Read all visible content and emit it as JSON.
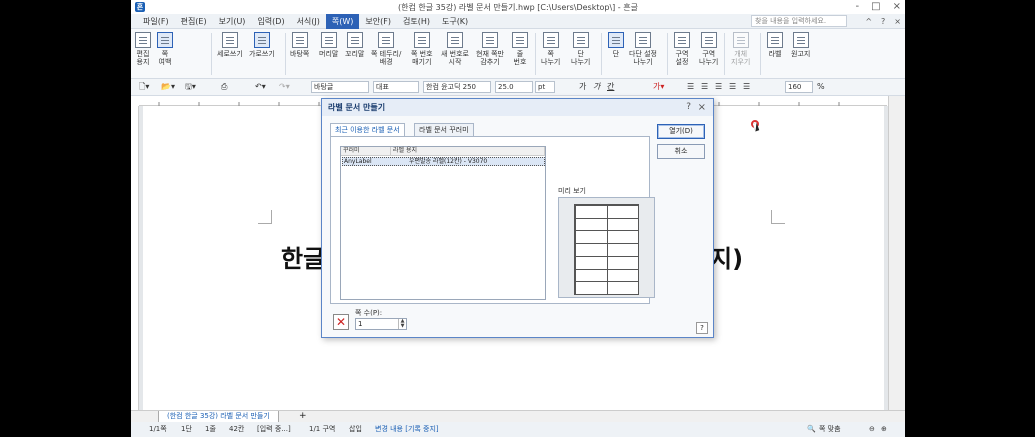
{
  "window": {
    "title": "(한컴 한글 35강) 라벨 문서 만들기.hwp [C:\\Users\\Desktop\\] - 흔글",
    "controls": [
      "-",
      "□",
      "×"
    ]
  },
  "menubar": {
    "items": [
      "파일(F)",
      "편집(E)",
      "보기(U)",
      "입력(D)",
      "서식(J)",
      "쪽(W)",
      "보안(F)",
      "검토(H)",
      "도구(K)"
    ],
    "active_index": 5,
    "search_placeholder": "찾을 내용을 입력하세요.",
    "right": [
      "^",
      "?",
      "×"
    ]
  },
  "ribbon": {
    "buttons": [
      {
        "label": "편집\n용지",
        "icon": "page-setup-icon"
      },
      {
        "label": "쪽\n여백",
        "icon": "page-margin-icon"
      },
      {
        "label": "세로쓰기",
        "icon": "vertical-writing-icon"
      },
      {
        "label": "가로쓰기",
        "icon": "horizontal-writing-icon",
        "selected": true
      },
      {
        "label": "바탕쪽",
        "icon": "master-page-icon"
      },
      {
        "label": "머리말",
        "icon": "header-icon"
      },
      {
        "label": "꼬리말",
        "icon": "footer-icon"
      },
      {
        "label": "쪽 테두리/\n배경",
        "icon": "page-border-icon"
      },
      {
        "label": "쪽 번호\n매기기",
        "icon": "page-number-icon"
      },
      {
        "label": "새 번호로\n시작",
        "icon": "new-number-icon"
      },
      {
        "label": "현재 쪽만\n감추기",
        "icon": "hide-icon"
      },
      {
        "label": "줄\n번호",
        "icon": "line-number-icon"
      },
      {
        "label": "쪽\n나누기",
        "icon": "page-break-icon"
      },
      {
        "label": "단\n나누기",
        "icon": "column-break-icon"
      },
      {
        "label": "단",
        "icon": "columns-icon",
        "selected": true
      },
      {
        "label": "다단 설정\n나누기",
        "icon": "multi-column-icon"
      },
      {
        "label": "구역\n설정",
        "icon": "section-setup-icon"
      },
      {
        "label": "구역\n나누기",
        "icon": "section-break-icon"
      },
      {
        "label": "개체\n지우기",
        "icon": "delete-object-icon"
      },
      {
        "label": "라벨",
        "icon": "label-icon"
      },
      {
        "label": "원고지",
        "icon": "manuscript-icon"
      }
    ]
  },
  "toolbar": {
    "style": "바탕글",
    "lang": "대표",
    "font": "한컴 윤고딕 250",
    "size": "25.0",
    "unit": "pt",
    "bold": "가",
    "italic": "가",
    "underline": "간",
    "zoom": "160",
    "zoom_unit": "%"
  },
  "document": {
    "heading_left": "한글",
    "heading_right": "지)"
  },
  "doc_tab": "(한컴 한글 35강) 라벨 문서 만들기",
  "status": {
    "page": "1/1쪽",
    "column": "1단",
    "line": "1줄",
    "col": "42칸",
    "mode": "[입력 중...]",
    "section": "1/1 구역",
    "insert": "삽입",
    "track": "변경 내용 [기록 중지]",
    "zoom_fit": "쪽 맞춤"
  },
  "dialog": {
    "title": "라벨 문서 만들기",
    "help": "?",
    "close": "×",
    "tabs": [
      "최근 이용한 라벨 문서",
      "라벨 문서 꾸러미"
    ],
    "active_tab": 0,
    "columns": [
      "꾸러미",
      "라벨 용지"
    ],
    "rows": [
      {
        "package": "AnyLabel",
        "paper": "우편발송 라벨(12칸) - V3070"
      }
    ],
    "preview_label": "미리 보기",
    "open_button": "열기(D)",
    "cancel_button": "취소",
    "count_label": "쪽 수(P):",
    "count_value": "1",
    "help_button": "?"
  }
}
